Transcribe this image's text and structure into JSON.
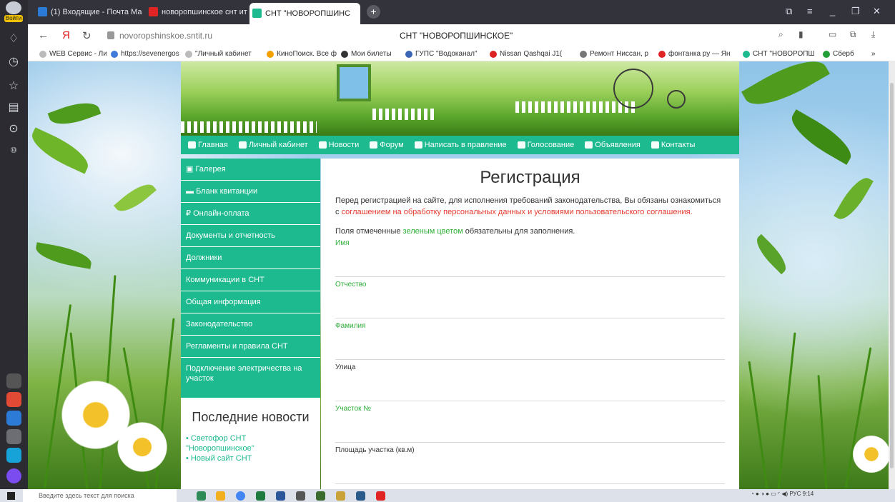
{
  "browser": {
    "login_label": "Войти",
    "tabs": [
      {
        "title": "(1) Входящие - Почта Ма",
        "fav": "#2a7ad6"
      },
      {
        "title": "новоропшинское снт ит",
        "fav": "#e02424"
      },
      {
        "title": "СНТ \"НОВОРОПШИНС",
        "fav": "#1db98f"
      }
    ],
    "new_tab": "+",
    "url": "novoropshinskoe.sntit.ru",
    "page_title": "СНТ \"НОВОРОПШИНСКОЕ\"",
    "bookmarks": [
      "WEB Сервис - Лич",
      "https://sevenergos",
      "\"Личный кабинет",
      "КиноПоиск. Все ф",
      "Мои билеты",
      "ГУПС \"Водоканал\"",
      "Nissan Qashqai J1(",
      "Ремонт Ниссан, р",
      "фонтанка ру — Ян",
      "СНТ \"НОВОРОПШ",
      "Сберб"
    ],
    "bookmark_more": "»"
  },
  "nav": [
    "Главная",
    "Личный кабинет",
    "Новости",
    "Форум",
    "Написать в правление",
    "Голосование",
    "Объявления",
    "Контакты"
  ],
  "sidebar": [
    "Галерея",
    "Бланк квитанции",
    "Онлайн-оплата",
    "Документы и отчетность",
    "Должники",
    "Коммуникации в СНТ",
    "Общая информация",
    "Законодательство",
    "Регламенты и правила СНТ",
    "Подключение электричества на участок"
  ],
  "news": {
    "title": "Последние новости",
    "items": [
      "• Светофор СНТ \"Новоропшинское\"",
      "• Новый сайт СНТ"
    ]
  },
  "form": {
    "title": "Регистрация",
    "intro_text": "Перед регистрацией на сайте, для исполнения требований законодательства, Вы обязаны ознакомиться с ",
    "intro_link": "соглашением на обработку персональных данных и условиями пользовательского соглашения.",
    "req_pre": "Поля отмеченные ",
    "req_green": "зеленым цветом",
    "req_post": " обязательны для заполнения.",
    "fields": [
      {
        "label": "Имя",
        "required": true
      },
      {
        "label": "Отчество",
        "required": true
      },
      {
        "label": "Фамилия",
        "required": true
      },
      {
        "label": "Улица",
        "required": false
      },
      {
        "label": "Участок №",
        "required": true
      },
      {
        "label": "Площадь участка (кв.м)",
        "required": false
      }
    ]
  },
  "taskbar": {
    "search_placeholder": "Введите здесь текст для поиска",
    "lang": "РУС",
    "time": "9:14"
  },
  "colors": {
    "accent": "#1db98f",
    "required_label": "#2fae3a",
    "link_red": "#e53b2e"
  }
}
